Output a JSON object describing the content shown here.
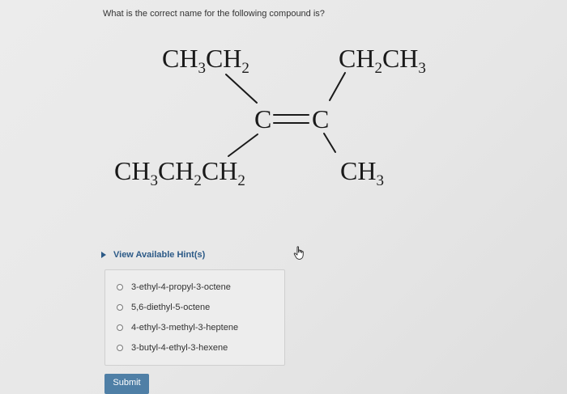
{
  "question": "What is the correct name for the following compound is?",
  "structure": {
    "top_left": {
      "a": "CH",
      "a_sub": "3",
      "b": "CH",
      "b_sub": "2"
    },
    "top_right": {
      "a": "CH",
      "a_sub": "2",
      "b": "CH",
      "b_sub": "3"
    },
    "bottom_left": {
      "a": "CH",
      "a_sub": "3",
      "b": "CH",
      "b_sub": "2",
      "c": "CH",
      "c_sub": "2"
    },
    "bottom_right": {
      "a": "CH",
      "a_sub": "3"
    },
    "center_left": "C",
    "center_right": "C"
  },
  "hint_label": "View Available Hint(s)",
  "options": [
    {
      "label": "3-ethyl-4-propyl-3-octene"
    },
    {
      "label": "5,6-diethyl-5-octene"
    },
    {
      "label": "4-ethyl-3-methyl-3-heptene"
    },
    {
      "label": "3-butyl-4-ethyl-3-hexene"
    }
  ],
  "submit_label": "Submit",
  "colors": {
    "link": "#2c5a87",
    "submit_bg": "#4f7fa6"
  }
}
